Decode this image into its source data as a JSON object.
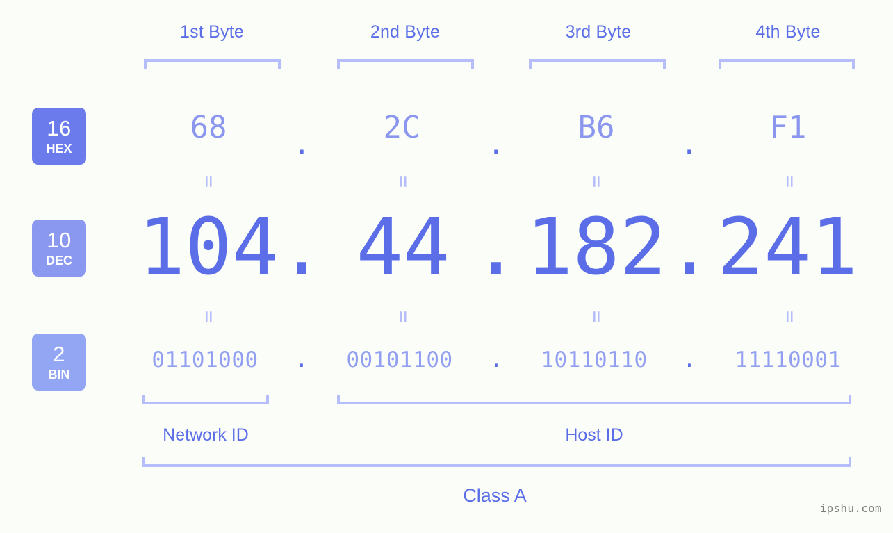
{
  "background_color": "#fbfdf8",
  "accent_color": "#5b6ee8",
  "accent_light_color": "#b6bdfb",
  "byte_headers": [
    {
      "label": "1st Byte"
    },
    {
      "label": "2nd Byte"
    },
    {
      "label": "3rd Byte"
    },
    {
      "label": "4th Byte"
    }
  ],
  "rows": {
    "hex": {
      "badge_number": "16",
      "badge_label": "HEX",
      "badge_color": "#6c7bec",
      "values": [
        "68",
        "2C",
        "B6",
        "F1"
      ],
      "separator": "."
    },
    "dec": {
      "badge_number": "10",
      "badge_label": "DEC",
      "badge_color": "#8b98f0",
      "values": [
        "104",
        "44",
        "182",
        "241"
      ],
      "separator": "."
    },
    "bin": {
      "badge_number": "2",
      "badge_label": "BIN",
      "badge_color": "#92a6f4",
      "values": [
        "01101000",
        "00101100",
        "10110110",
        "11110001"
      ],
      "separator": "."
    }
  },
  "equality_marks": [
    "=",
    "=",
    "=",
    "=",
    "=",
    "=",
    "=",
    "="
  ],
  "sections": {
    "network_id": "Network ID",
    "host_id": "Host ID",
    "class": "Class A"
  },
  "watermark": "ipshu.com"
}
